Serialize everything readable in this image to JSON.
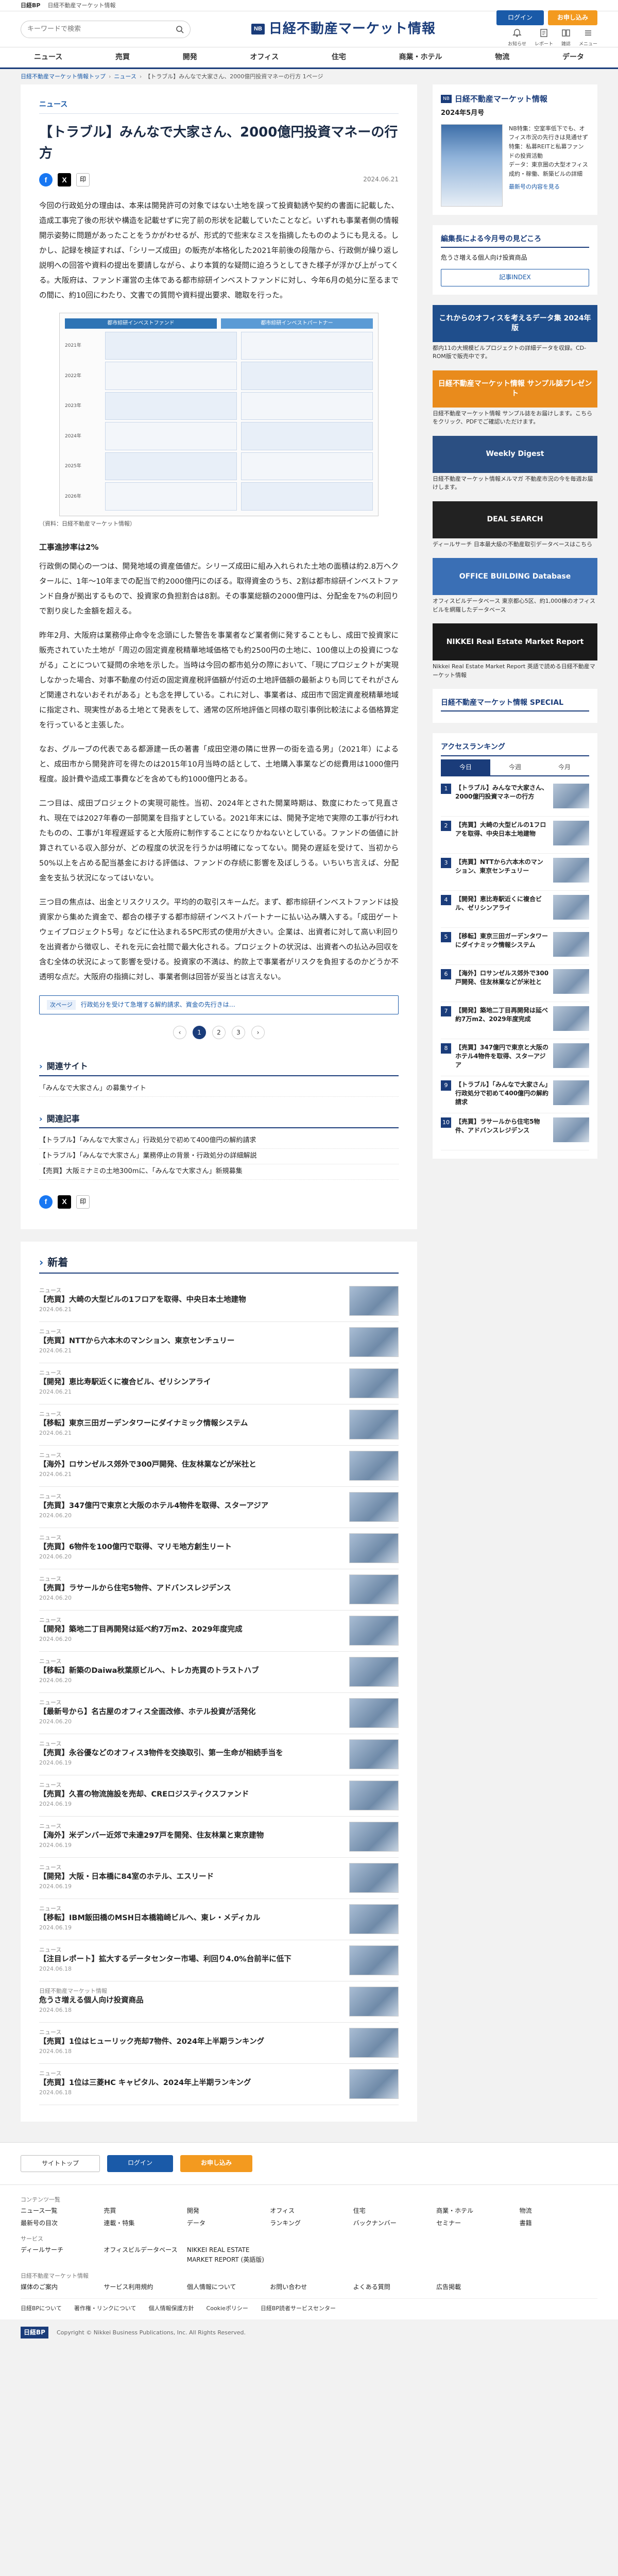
{
  "topbar": {
    "brand": "日経BP",
    "site": "日経不動産マーケット情報",
    "links": [
      "日経BPトップ",
      "お問い合わせ"
    ]
  },
  "header": {
    "search_placeholder": "キーワードで検索",
    "logo_badge": "NB",
    "logo_text": "日経不動産マーケット情報",
    "login_label": "ログイン",
    "apply_label": "お申し込み",
    "icons": [
      {
        "name": "notice-icon",
        "label": "お知らせ"
      },
      {
        "name": "report-icon",
        "label": "レポート"
      },
      {
        "name": "magazine-icon",
        "label": "雑誌"
      },
      {
        "name": "menu-icon",
        "label": "メニュー"
      }
    ]
  },
  "nav": [
    "ニュース",
    "売買",
    "開発",
    "オフィス",
    "住宅",
    "商業・ホテル",
    "物流",
    "データ"
  ],
  "breadcrumb": {
    "items": [
      "日経不動産マーケット情報トップ",
      "ニュース"
    ],
    "current": "【トラブル】みんなで大家さん、2000億円投資マネーの行方 1ページ"
  },
  "article": {
    "category": "ニュース",
    "title": "【トラブル】みんなで大家さん、2000億円投資マネーの行方",
    "date": "2024.06.21",
    "print_label": "印",
    "paragraphs": [
      "今回の行政処分の理由は、本来は開発許可の対象ではない土地を誤って投資勧誘や契約の書面に記載した、造成工事完了後の形状や構造を記載せずに完了前の形状を記載していたことなど。いずれも事業者側の情報開示姿勢に問題があったことをうかがわせるが、形式的で些末なミスを指摘したもののようにも見える。しかし、記録を検証すれば、「シリーズ成田」の販売が本格化した2021年前後の段階から、行政側が繰り返し説明への回答や資料の提出を要請しながら、より本質的な疑問に迫ろうとしてきた様子が浮かび上がってくる。大阪府は、ファンド運営の主体である都市綜研インベストファンドに対し、今年6月の処分に至るまでの間に、約10回にわたり、文書での質問や資料提出要求、聴取を行った。",
      "行政側の関心の一つは、開発地域の資産価値だ。シリーズ成田に組み入れられた土地の面積は約2.8万ヘクタールに、1年～10年までの配当で約2000億円にのぼる。取得資金のうち、2割は都市綜研インベストファンド自身が拠出するもので、投資家の負担割合は8割。その事業総額の2000億円は、分配金を7%の利回りで割り戻した金額を超える。",
      "昨年2月、大阪府は業務停止命令を念頭にした警告を事業者など業者側に発することもし、成田で投資家に販売されていた土地が「周辺の固定資産税精華地域価格でも約2500円の土地に、100億以上の投資につながる」ことについて疑問の余地を示した。当時は今回の都市処分の際において、「現にプロジェクトが実現しなかった場合、対事不動産の付近の固定資産税評価額が付近の土地評価額の最新よりも同じてそれがさんど関連されないおそれがある」とも念を押している。これに対し、事業者は、成田市で固定資産税精華地域に指定され、現実性がある土地とて発表をして、通常の区所地評価と同様の取引事例比較法による価格算定を行っていると主張した。",
      "なお、グループの代表である都源建一氏の著書「成田空港の隣に世界一の街を造る男」（2021年）によると、成田市から開発許可を得たのは2015年10月当時の話として、土地購入事業などの総費用は1000億円程度。設計費や造成工事費などを含めても約1000億円とある。",
      "二つ目は、成田プロジェクトの実現可能性。当初、2024年とされた開業時期は、数度にわたって見直され、現在では2027年春の一部開業を目指すとしている。2021年末には、開発予定地で実際の工事が行われたものの、工事が1年程遅延すると大阪府に制作することになりかねないとしている。ファンドの価値に計算されている収入部分が、どの程度の状況を行うかは明確になってない。開発の遅延を受けて、当初から50%以上を占める配当基金における評価は、ファンドの存続に影響を及ぼしうる。いちいち言えば、分配金を支払う状況になってはいない。",
      "三つ目の焦点は、出金とリスクリスク。平均的の取引スキームだ。まず、都市綜研インベストファンドは投資家から集めた資金で、都合の様子する都市綜研インベストパートナーに払い込み購入する。「成田ゲートウェイプロジェクト5号」などに仕込まれる5PC形式の使用が大きい。企業は、出資者に対して高い利回りを出資者から徴収し、それを元に会社間で最大化される。プロジェクトの状況は、出資者への払込み回収を含む全体の状況によって影響を受ける。投資家の不満は、約款上で事業者がリスクを負担するのかどうか不透明な点だ。大阪府の指摘に対し、事業者側は回答が妥当とは言えない。"
    ],
    "subheading": "工事進捗率は2%",
    "figure_caption": "（資料：日経不動産マーケット情報）",
    "figure_headers": [
      "都市綜研インベストファンド",
      "都市綜研インベストパートナー"
    ],
    "figure_rows": [
      "2021年",
      "2022年",
      "2023年",
      "2024年",
      "2025年",
      "2026年"
    ],
    "related_tag": "次ページ",
    "related_text": "行政処分を受けて急増する解約請求、資金の先行きは…",
    "pages": [
      "1",
      "2",
      "3"
    ],
    "related_site_title": "関連サイト",
    "related_site_items": [
      "「みんなで大家さん」の募集サイト"
    ],
    "related_article_title": "関連記事",
    "related_articles": [
      "【トラブル】「みんなで大家さん」行政処分で初めて400億円の解約請求",
      "【トラブル】「みんなで大家さん」業務停止の背景・行政処分の詳細解説",
      "【売買】大阪ミナミの土地300mに、「みんなで大家さん」新規募集"
    ]
  },
  "news": {
    "title": "新着",
    "items": [
      {
        "cat": "ニュース",
        "title": "【売買】大崎の大型ビルの1フロアを取得、中央日本土地建物",
        "date": "2024.06.21"
      },
      {
        "cat": "ニュース",
        "title": "【売買】NTTから六本木のマンション、東京センチュリー",
        "date": "2024.06.21"
      },
      {
        "cat": "ニュース",
        "title": "【開発】恵比寿駅近くに複合ビル、ゼリシンアライ",
        "date": "2024.06.21"
      },
      {
        "cat": "ニュース",
        "title": "【移転】東京三田ガーデンタワーにダイナミック情報システム",
        "date": "2024.06.21"
      },
      {
        "cat": "ニュース",
        "title": "【海外】ロサンゼルス郊外で300戸開発、住友林業などが米社と",
        "date": "2024.06.21"
      },
      {
        "cat": "ニュース",
        "title": "【売買】347億円で東京と大阪のホテル4物件を取得、スターアジア",
        "date": "2024.06.20"
      },
      {
        "cat": "ニュース",
        "title": "【売買】6物件を100億円で取得、マリモ地方創生リート",
        "date": "2024.06.20"
      },
      {
        "cat": "ニュース",
        "title": "【売買】ラサールから住宅5物件、アドバンスレジデンス",
        "date": "2024.06.20"
      },
      {
        "cat": "ニュース",
        "title": "【開発】築地二丁目再開発は延べ約7万m2、2029年度完成",
        "date": "2024.06.20"
      },
      {
        "cat": "ニュース",
        "title": "【移転】新築のDaiwa秋葉原ビルへ、トレカ売買のトラストハブ",
        "date": "2024.06.20"
      },
      {
        "cat": "ニュース",
        "title": "【最新号から】名古屋のオフィス全面改修、ホテル投資が活発化",
        "date": "2024.06.20"
      },
      {
        "cat": "ニュース",
        "title": "【売買】永谷優などのオフィス3物件を交換取引、第一生命が相続手当を",
        "date": "2024.06.19"
      },
      {
        "cat": "ニュース",
        "title": "【売買】久喜の物流施設を売却、CREロジスティクスファンド",
        "date": "2024.06.19"
      },
      {
        "cat": "ニュース",
        "title": "【海外】米デンバー近郊で未達297戸を開発、住友林業と東京建物",
        "date": "2024.06.19"
      },
      {
        "cat": "ニュース",
        "title": "【開発】大阪・日本橋に84室のホテル、エスリード",
        "date": "2024.06.19"
      },
      {
        "cat": "ニュース",
        "title": "【移転】IBM飯田橋のMSH日本橋箱崎ビルへ、東レ・メディカル",
        "date": "2024.06.19"
      },
      {
        "cat": "ニュース",
        "title": "【注目レポート】拡大するデータセンター市場、利回り4.0%台前半に低下",
        "date": "2024.06.18"
      },
      {
        "cat": "日経不動産マーケット情報",
        "title": "危うさ増える個人向け投資商品",
        "date": "2024.06.18"
      },
      {
        "cat": "ニュース",
        "title": "【売買】1位はヒューリック売却7物件、2024年上半期ランキング",
        "date": "2024.06.18"
      },
      {
        "cat": "ニュース",
        "title": "【売買】1位は三菱HC キャピタル、2024年上半期ランキング",
        "date": "2024.06.18"
      }
    ]
  },
  "sidebar": {
    "magazine": {
      "badge": "NB",
      "title": "日経不動産マーケット情報",
      "issue": "2024年5月号",
      "lines": [
        "NB特集：空室率低下でも、オフィス市況の先行きは見通せず",
        "特集：私募REITと私募ファンドの投資活動",
        "データ：東京圏の大型オフィス成約・稼働、新築ビルの詳細"
      ],
      "link": "最新号の内容を見る"
    },
    "notice": {
      "title": "編集長による今月号の見どころ",
      "items": [
        "危うさ増える個人向け投資商品"
      ],
      "index_label": "記事INDEX"
    },
    "banners": [
      {
        "name": "office-data-banner",
        "img": "これからのオフィスを考えるデータ集 2024年版",
        "text": "都内11の大規模ビルプロジェクトの詳細データを収録。CD-ROM版で販売中です。",
        "color": "#1f4e8c"
      },
      {
        "name": "sample-banner",
        "img": "日経不動産マーケット情報 サンプル誌プレゼント",
        "text": "日経不動産マーケット情報 サンプル誌をお届けします。こちらをクリック、PDFでご確認いただけます。",
        "color": "#e98b1c"
      },
      {
        "name": "weekly-digest-banner",
        "img": "Weekly Digest",
        "text": "日経不動産マーケット情報メルマガ 不動産市況の今を毎週お届けします。",
        "color": "#2b4f82"
      },
      {
        "name": "deal-search-banner",
        "img": "DEAL SEARCH",
        "text": "ディールサーチ 日本最大級の不動産取引データベースはこちら",
        "color": "#222"
      },
      {
        "name": "office-building-banner",
        "img": "OFFICE BUILDING Database",
        "text": "オフィスビルデータベース 東京都心5区、約1,000棟のオフィスビルを網羅したデータベース",
        "color": "#3a6fb5"
      },
      {
        "name": "nikkei-report-banner",
        "img": "NIKKEI Real Estate Market Report",
        "text": "Nikkei Real Estate Market Report 英語で読める日経不動産マーケット情報",
        "color": "#1a1a1a"
      }
    ],
    "special_title": "日経不動産マーケット情報 SPECIAL",
    "ranking_title": "アクセスランキング",
    "ranking_tabs": [
      "今日",
      "今週",
      "今月"
    ],
    "ranking": [
      "【トラブル】みんなで大家さん、2000億円投資マネーの行方",
      "【売買】大崎の大型ビルの1フロアを取得、中央日本土地建物",
      "【売買】NTTから六本木のマンション、東京センチュリー",
      "【開発】恵比寿駅近くに複合ビル、ゼリシンアライ",
      "【移転】東京三田ガーデンタワーにダイナミック情報システム",
      "【海外】ロサンゼルス郊外で300戸開発、住友林業などが米社と",
      "【開発】築地二丁目再開発は延べ約7万m2、2029年度完成",
      "【売買】347億円で東京と大阪のホテル4物件を取得、スターアジア",
      "【トラブル】「みんなで大家さん」行政処分で初めて400億円の解約請求",
      "【売買】ラサールから住宅5物件、アドバンスレジデンス"
    ]
  },
  "footer": {
    "top_buttons": [
      "サイトトップ",
      "ログイン",
      "お申し込み"
    ],
    "sections": [
      {
        "heading": "コンテンツ一覧",
        "items": [
          "ニュース一覧",
          "売買",
          "開発",
          "オフィス",
          "住宅",
          "商業・ホテル",
          "物流",
          "最新号の目次",
          "連載・特集",
          "データ",
          "ランキング",
          "バックナンバー",
          "セミナー",
          "書籍"
        ]
      },
      {
        "heading": "サービス",
        "items": [
          "ディールサーチ",
          "オフィスビルデータベース",
          "NIKKEI REAL ESTATE MARKET REPORT (英語版)"
        ]
      },
      {
        "heading": "日経不動産マーケット情報",
        "items": [
          "媒体のご案内",
          "サービス利用規約",
          "個人情報について",
          "お問い合わせ",
          "よくある質問",
          "広告掲載"
        ]
      }
    ],
    "links": [
      "日経BPについて",
      "著作権・リンクについて",
      "個人情報保護方針",
      "Cookieポリシー",
      "日経BP読者サービスセンター"
    ],
    "brand": "日経BP",
    "copyright": "Copyright © Nikkei Business Publications, Inc. All Rights Reserved."
  }
}
